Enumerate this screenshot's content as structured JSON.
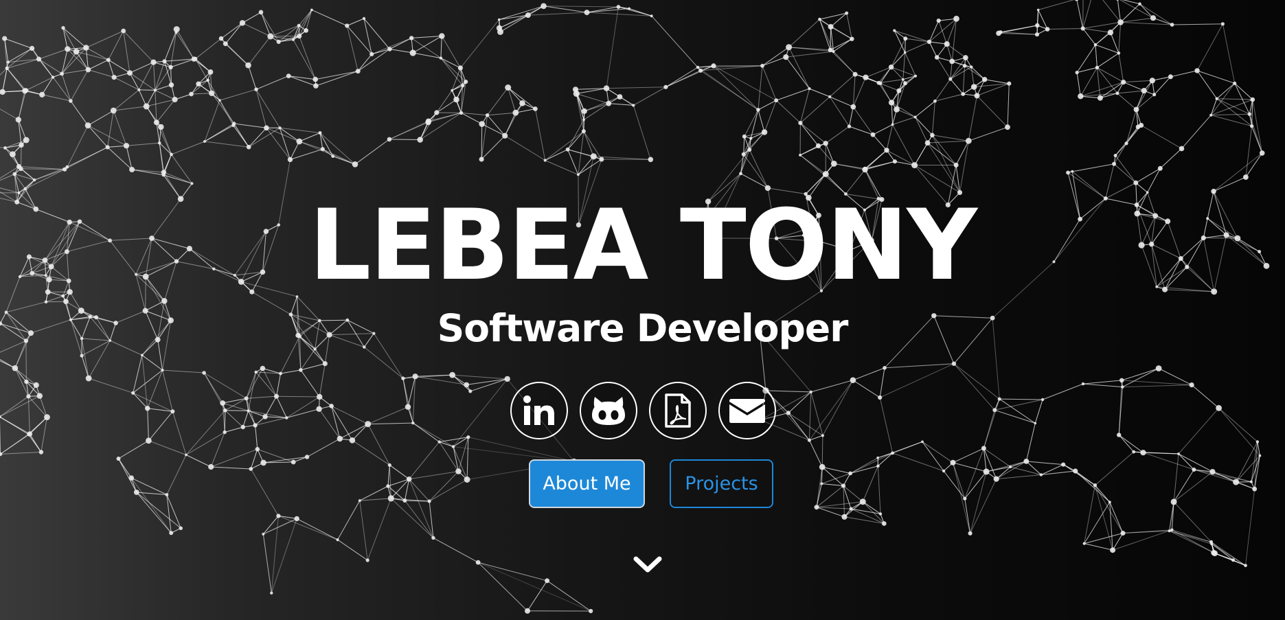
{
  "hero": {
    "name": "LEBEA TONY",
    "role": "Software Developer"
  },
  "social": [
    {
      "label": "LinkedIn",
      "icon": "linkedin-icon"
    },
    {
      "label": "GitHub",
      "icon": "github-icon"
    },
    {
      "label": "Resume PDF",
      "icon": "pdf-icon"
    },
    {
      "label": "Email",
      "icon": "email-icon"
    }
  ],
  "actions": {
    "about_label": "About Me",
    "projects_label": "Projects"
  },
  "scroll": {
    "icon": "chevron-down-icon"
  },
  "colors": {
    "accent": "#1e88d8",
    "text": "#ffffff",
    "background_dark": "#060606",
    "background_light": "#3a3a3a"
  }
}
